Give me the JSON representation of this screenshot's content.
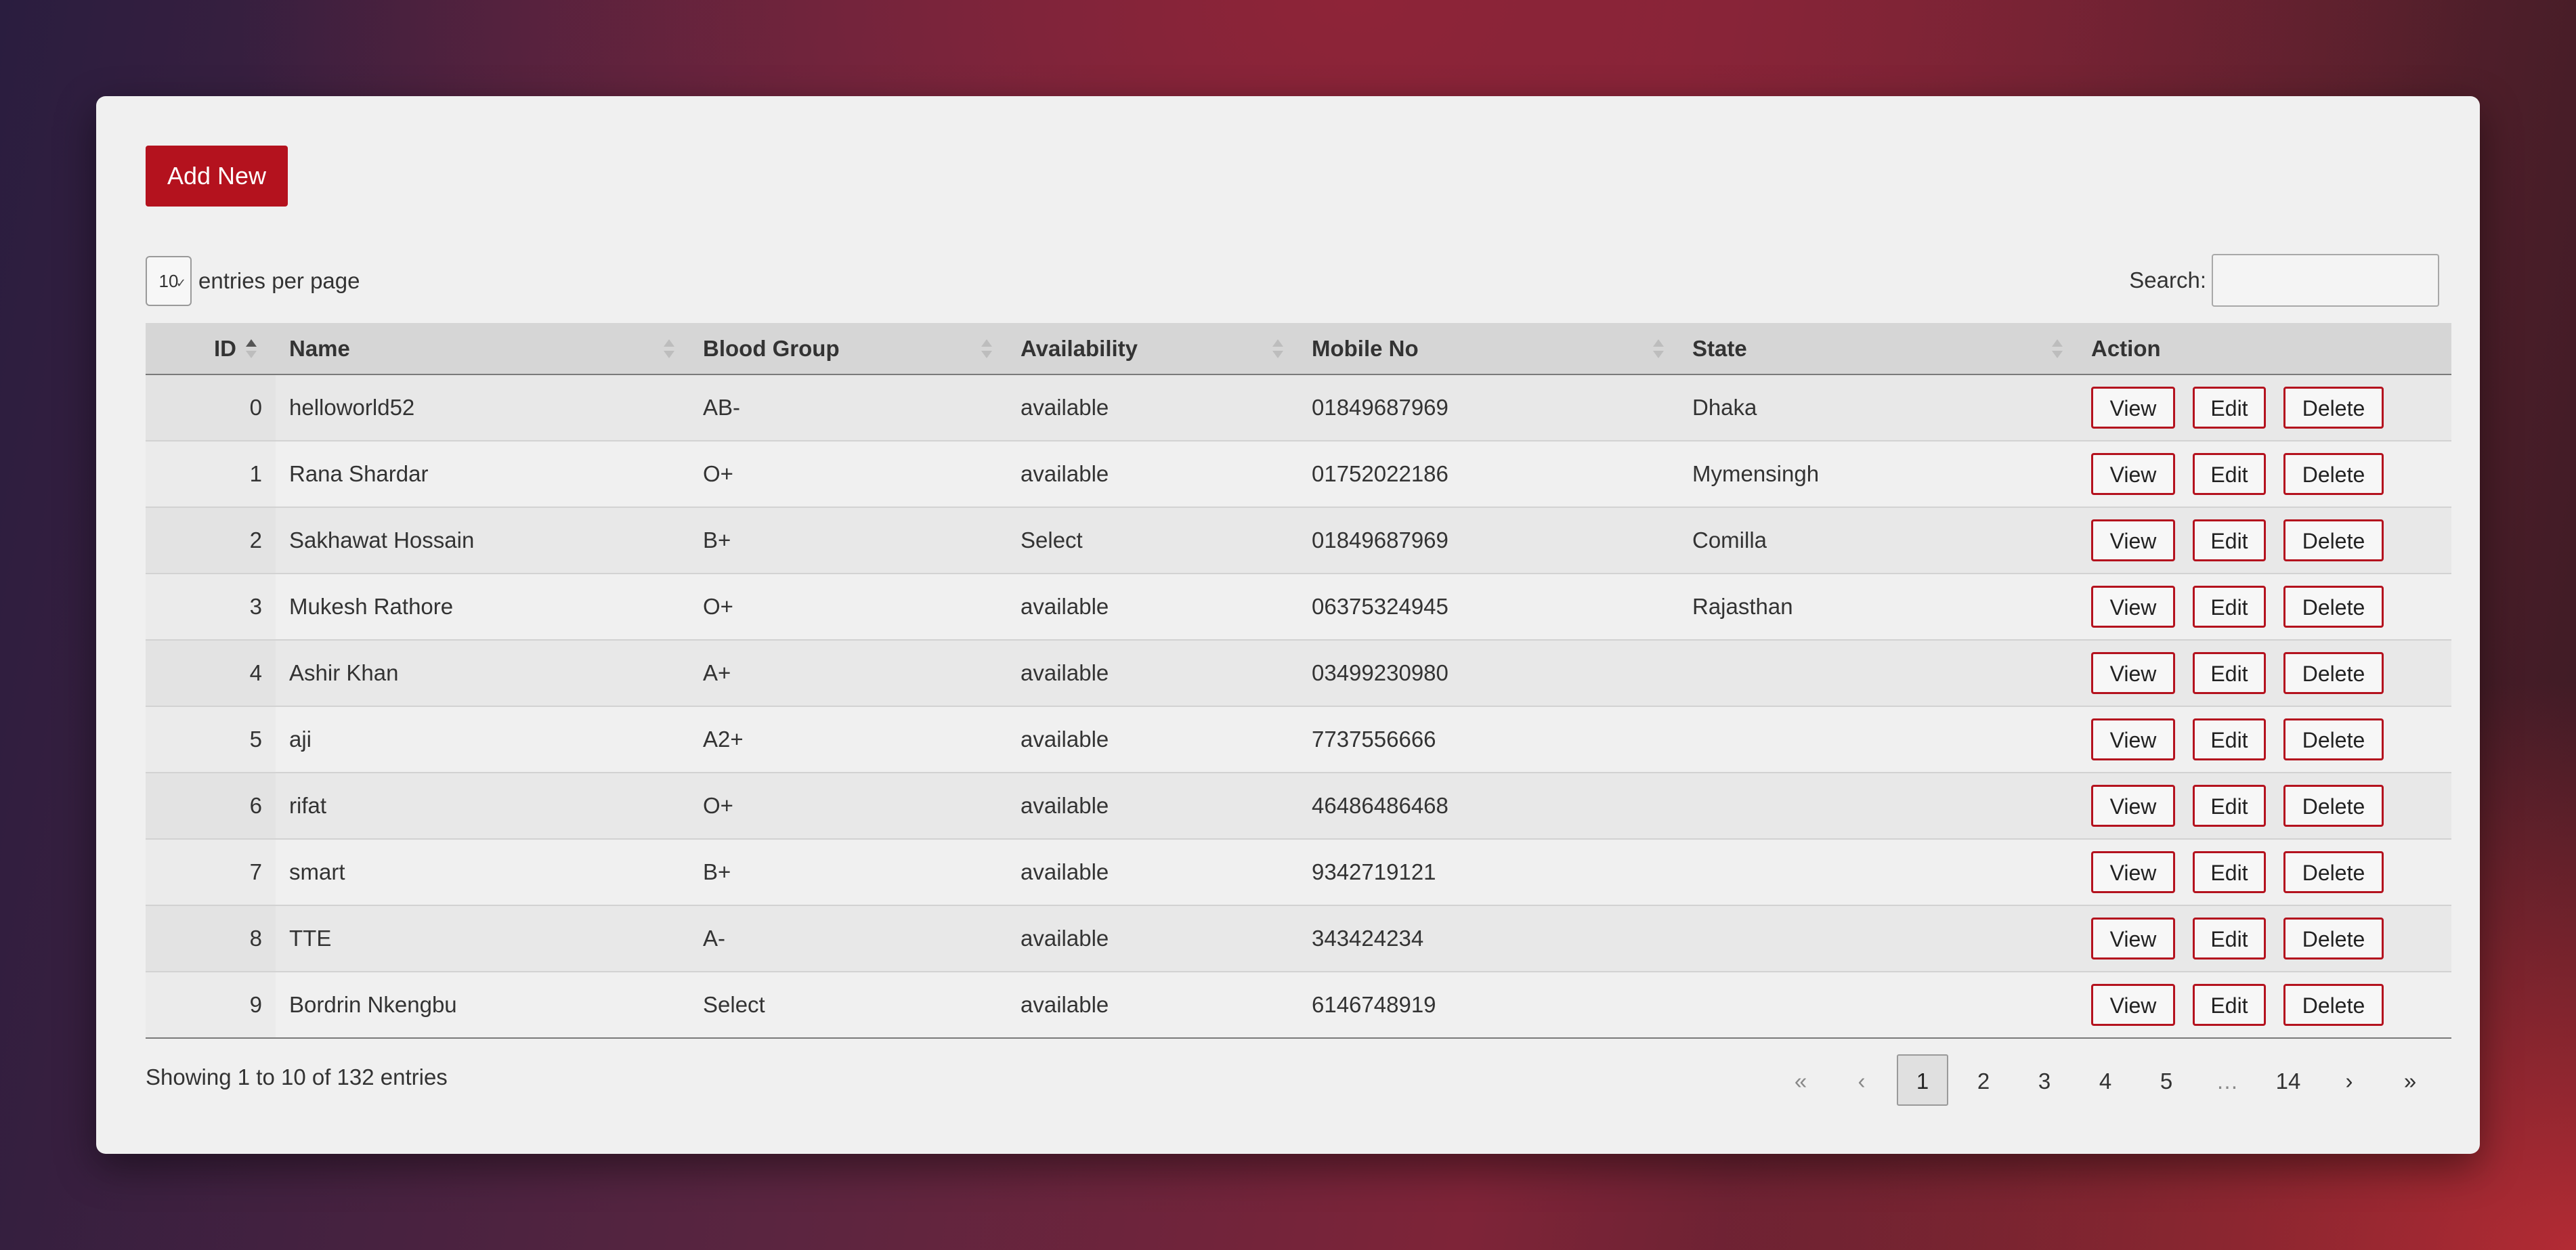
{
  "toolbar": {
    "add_label": "Add New"
  },
  "length_menu": {
    "value": "10",
    "label": "entries per page"
  },
  "search": {
    "label": "Search:",
    "value": "",
    "placeholder": ""
  },
  "columns": [
    "ID",
    "Name",
    "Blood Group",
    "Availability",
    "Mobile No",
    "State",
    "Action"
  ],
  "actions": {
    "view": "View",
    "edit": "Edit",
    "delete": "Delete"
  },
  "rows": [
    {
      "id": "0",
      "name": "helloworld52",
      "blood": "AB-",
      "availability": "available",
      "mobile": "01849687969",
      "state": "Dhaka"
    },
    {
      "id": "1",
      "name": "Rana Shardar",
      "blood": "O+",
      "availability": "available",
      "mobile": "01752022186",
      "state": "Mymensingh"
    },
    {
      "id": "2",
      "name": "Sakhawat Hossain",
      "blood": "B+",
      "availability": "Select",
      "mobile": "01849687969",
      "state": "Comilla"
    },
    {
      "id": "3",
      "name": "Mukesh Rathore",
      "blood": "O+",
      "availability": "available",
      "mobile": "06375324945",
      "state": "Rajasthan"
    },
    {
      "id": "4",
      "name": "Ashir Khan",
      "blood": "A+",
      "availability": "available",
      "mobile": "03499230980",
      "state": ""
    },
    {
      "id": "5",
      "name": "aji",
      "blood": "A2+",
      "availability": "available",
      "mobile": "7737556666",
      "state": ""
    },
    {
      "id": "6",
      "name": "rifat",
      "blood": "O+",
      "availability": "available",
      "mobile": "46486486468",
      "state": ""
    },
    {
      "id": "7",
      "name": "smart",
      "blood": "B+",
      "availability": "available",
      "mobile": "9342719121",
      "state": ""
    },
    {
      "id": "8",
      "name": "TTE",
      "blood": "A-",
      "availability": "available",
      "mobile": "343424234",
      "state": ""
    },
    {
      "id": "9",
      "name": "Bordrin Nkengbu",
      "blood": "Select",
      "availability": "available",
      "mobile": "6146748919",
      "state": ""
    }
  ],
  "info": "Showing 1 to 10 of 132 entries",
  "pagination": {
    "first": "«",
    "prev": "‹",
    "pages": [
      "1",
      "2",
      "3",
      "4",
      "5",
      "…",
      "14"
    ],
    "current": "1",
    "next": "›",
    "last": "»"
  }
}
